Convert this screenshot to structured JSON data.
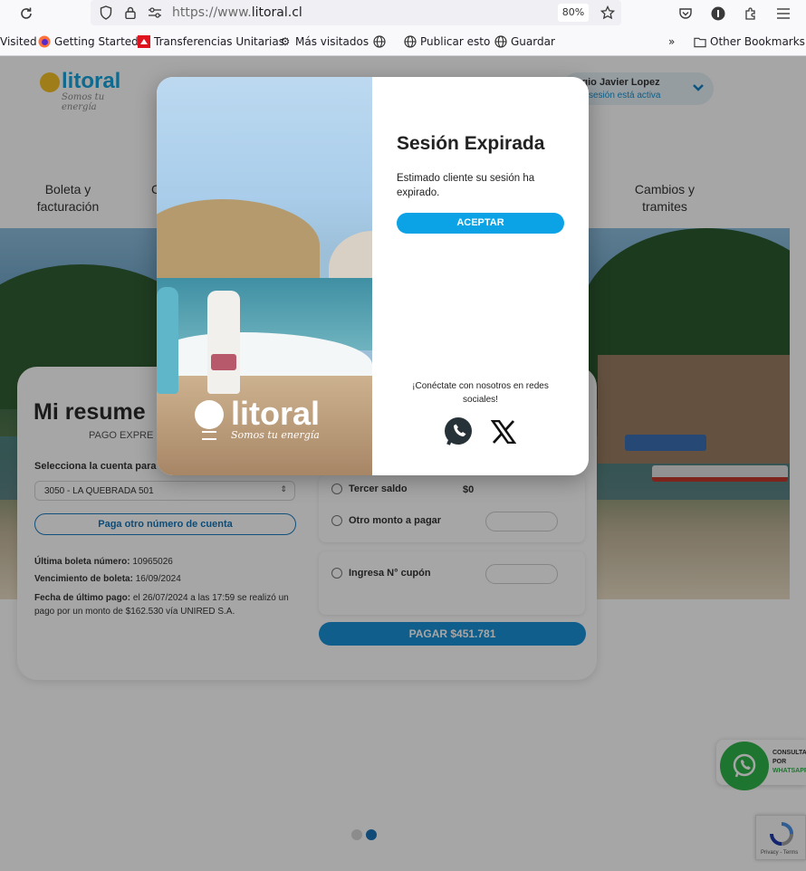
{
  "browser": {
    "url_prefix": "https://www.",
    "url_domain": "litoral.cl",
    "zoom": "80%",
    "bookmarks": [
      {
        "label": "Visited",
        "icon": "none"
      },
      {
        "label": "Getting Started",
        "icon": "firefox-icon"
      },
      {
        "label": "Transferencias Unitarias",
        "icon": "bank-icon"
      },
      {
        "label": "Más visitados",
        "icon": "gear-icon"
      },
      {
        "label": "",
        "icon": "globe-icon"
      },
      {
        "label": "Publicar esto",
        "icon": "globe-icon"
      },
      {
        "label": "Guardar",
        "icon": "globe-icon"
      }
    ],
    "other_bookmarks": "Other Bookmarks"
  },
  "site": {
    "logo_word": "litoral",
    "logo_tagline": "Somos tu energía",
    "user": {
      "name": "ergio Javier Lopez",
      "status": "sesión está activa"
    },
    "nav": [
      {
        "label": "Boleta y facturación"
      },
      {
        "label": "C"
      },
      {
        "label": "Cambios y tramites"
      }
    ]
  },
  "summary": {
    "title": "Mi resume",
    "subtitle": "PAGO EXPRE",
    "select_label": "Selecciona la cuenta para",
    "account_value": "3050 - LA QUEBRADA 501",
    "other_account_button": "Paga otro número de cuenta",
    "last_bill_label": "Última boleta número:",
    "last_bill_value": "10965026",
    "due_label": "Vencimiento de boleta:",
    "due_value": "16/09/2024",
    "last_payment_label": "Fecha de último pago:",
    "last_payment_value": "el 26/07/2024 a las 17:59 se realizó un pago por un monto de $162.530 vía UNIRED S.A.",
    "pay_options": [
      {
        "label": "Tercer saldo",
        "amount": "$0"
      },
      {
        "label": "Otro monto a pagar",
        "amount": ""
      }
    ],
    "coupon_label": "Ingresa N° cupón",
    "pay_button": "PAGAR $451.781"
  },
  "whatsapp_widget": {
    "line1": "CONSULTA",
    "line2": "POR",
    "line3": "WHATSAPP"
  },
  "recaptcha": {
    "text": "Privacy - Terms"
  },
  "modal": {
    "title": "Sesión Expirada",
    "message": "Estimado cliente su sesión ha expirado.",
    "accept_button": "ACEPTAR",
    "social_text": "¡Conéctate con nosotros en redes sociales!",
    "photo_logo_word": "litoral",
    "photo_logo_tagline": "Somos tu energía"
  },
  "colors": {
    "brand_blue": "#0ba3e6",
    "brand_yellow": "#f5c125",
    "whatsapp_green": "#2fb44a"
  }
}
